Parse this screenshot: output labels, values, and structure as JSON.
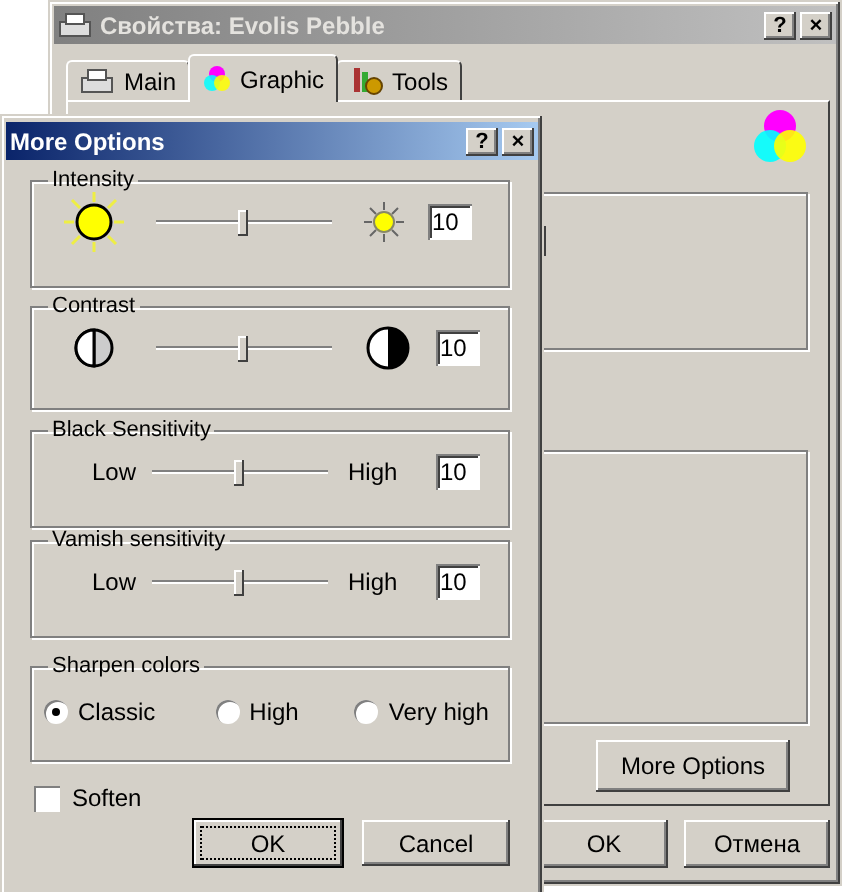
{
  "back_window": {
    "title": "Свойства: Evolis Pebble",
    "title_buttons": [
      "?",
      "×"
    ],
    "tabs": [
      {
        "label": "Main",
        "selected": false
      },
      {
        "label": "Graphic",
        "selected": true
      },
      {
        "label": "Tools",
        "selected": false
      }
    ],
    "more_options_button": "More Options",
    "buttons": [
      "OK",
      "Отмена"
    ]
  },
  "dialog": {
    "title": "More Options",
    "title_buttons": [
      "?",
      "×"
    ],
    "groups": [
      {
        "kind": "intensity",
        "title": "Intensity",
        "level": 0.5,
        "value": "10"
      },
      {
        "kind": "contrast",
        "title": "Contrast",
        "level": 0.5,
        "value": "10"
      },
      {
        "kind": "labels",
        "title": "Black Sensitivity",
        "low": "Low",
        "high": "High",
        "level": 0.5,
        "value": "10"
      },
      {
        "kind": "labels",
        "title": "Vamish sensitivity",
        "low": "Low",
        "high": "High",
        "level": 0.5,
        "value": "10"
      }
    ],
    "sharpen": {
      "title": "Sharpen colors",
      "options": [
        {
          "label": "Classic",
          "selected": true
        },
        {
          "label": "High",
          "selected": false
        },
        {
          "label": "Very high",
          "selected": false
        }
      ]
    },
    "soften": {
      "label": "Soften",
      "checked": false
    },
    "buttons": [
      "OK",
      "Cancel"
    ]
  }
}
